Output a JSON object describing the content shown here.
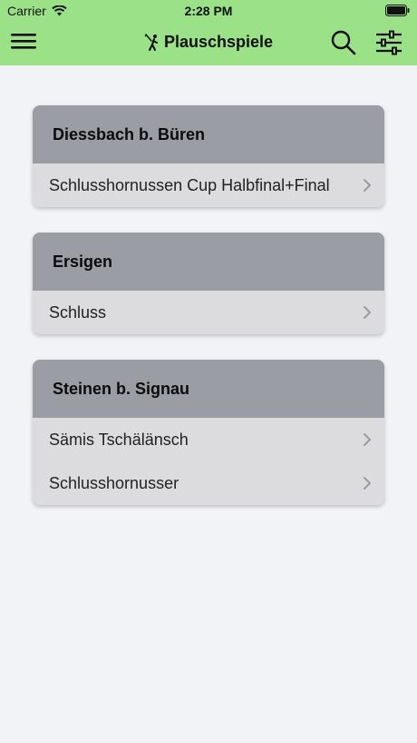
{
  "status_bar": {
    "carrier": "Carrier",
    "time": "2:28 PM"
  },
  "nav": {
    "title": "Plauschspiele",
    "title_icon": "hornusser-player-icon",
    "left_icon": "hamburger-menu-icon",
    "right_icons": [
      "search-icon",
      "filter-sliders-icon"
    ]
  },
  "colors": {
    "topbar": "#9ae188",
    "background": "#f2f3f7",
    "card_header": "#9b9da4",
    "card_row": "#dcdcde"
  },
  "groups": [
    {
      "location": "Diessbach b. Büren",
      "events": [
        "Schlusshornussen Cup Halbfinal+Final"
      ]
    },
    {
      "location": "Ersigen",
      "events": [
        "Schluss"
      ]
    },
    {
      "location": "Steinen b. Signau",
      "events": [
        "Sämis Tschälänsch",
        "Schlusshornusser"
      ]
    }
  ]
}
